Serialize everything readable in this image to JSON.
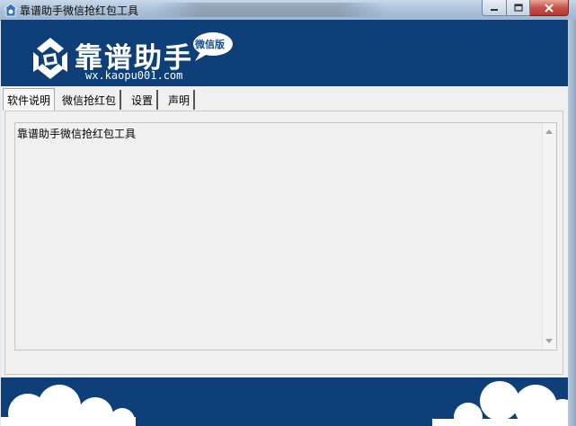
{
  "window": {
    "title": "靠谱助手微信抢红包工具",
    "app_icon": "app-icon",
    "caption_buttons": [
      {
        "name": "minimize",
        "icon": "minimize-icon"
      },
      {
        "name": "maximize",
        "icon": "maximize-icon"
      },
      {
        "name": "close",
        "icon": "close-icon"
      }
    ]
  },
  "banner": {
    "brand_name": "靠谱助手",
    "edition": "微信版",
    "url": "wx.kaopu001.com",
    "background_color": "#0e3f78"
  },
  "tabs": [
    {
      "label": "软件说明",
      "active": true
    },
    {
      "label": "微信抢红包",
      "active": false
    },
    {
      "label": "设置",
      "active": false
    },
    {
      "label": "声明",
      "active": false
    }
  ],
  "content": {
    "text": "靠谱助手微信抢红包工具"
  },
  "colors": {
    "banner": "#0e3f78",
    "panel": "#f0f0f0",
    "close_button": "#c75050"
  }
}
